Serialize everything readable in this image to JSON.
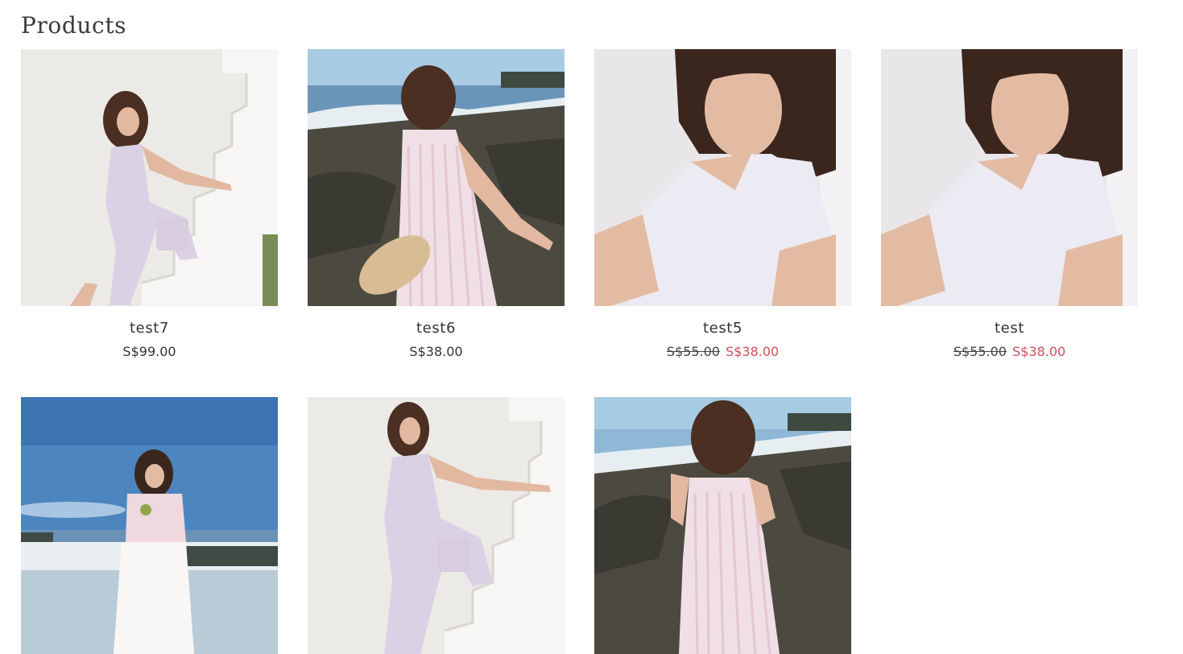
{
  "page": {
    "title": "Products"
  },
  "colors": {
    "sale_price": "#d0505c",
    "text": "#333333",
    "background": "#ffffff"
  },
  "products": [
    {
      "name": "test7",
      "price": "S$99.00",
      "compare_at_price": "",
      "image_icon": "photo-model-stairs-jumpsuit"
    },
    {
      "name": "test6",
      "price": "S$38.00",
      "compare_at_price": "",
      "image_icon": "photo-model-beach-dress-back"
    },
    {
      "name": "test5",
      "price": "S$38.00",
      "compare_at_price": "S$55.00",
      "image_icon": "photo-model-wall-top-closeup"
    },
    {
      "name": "test",
      "price": "S$38.00",
      "compare_at_price": "S$55.00",
      "image_icon": "photo-model-wall-top-closeup"
    },
    {
      "name": "",
      "price": "",
      "compare_at_price": "",
      "image_icon": "photo-model-beach-white-skirt"
    },
    {
      "name": "",
      "price": "",
      "compare_at_price": "",
      "image_icon": "photo-model-stairs-jumpsuit"
    },
    {
      "name": "",
      "price": "",
      "compare_at_price": "",
      "image_icon": "photo-model-beach-dress-back"
    }
  ]
}
